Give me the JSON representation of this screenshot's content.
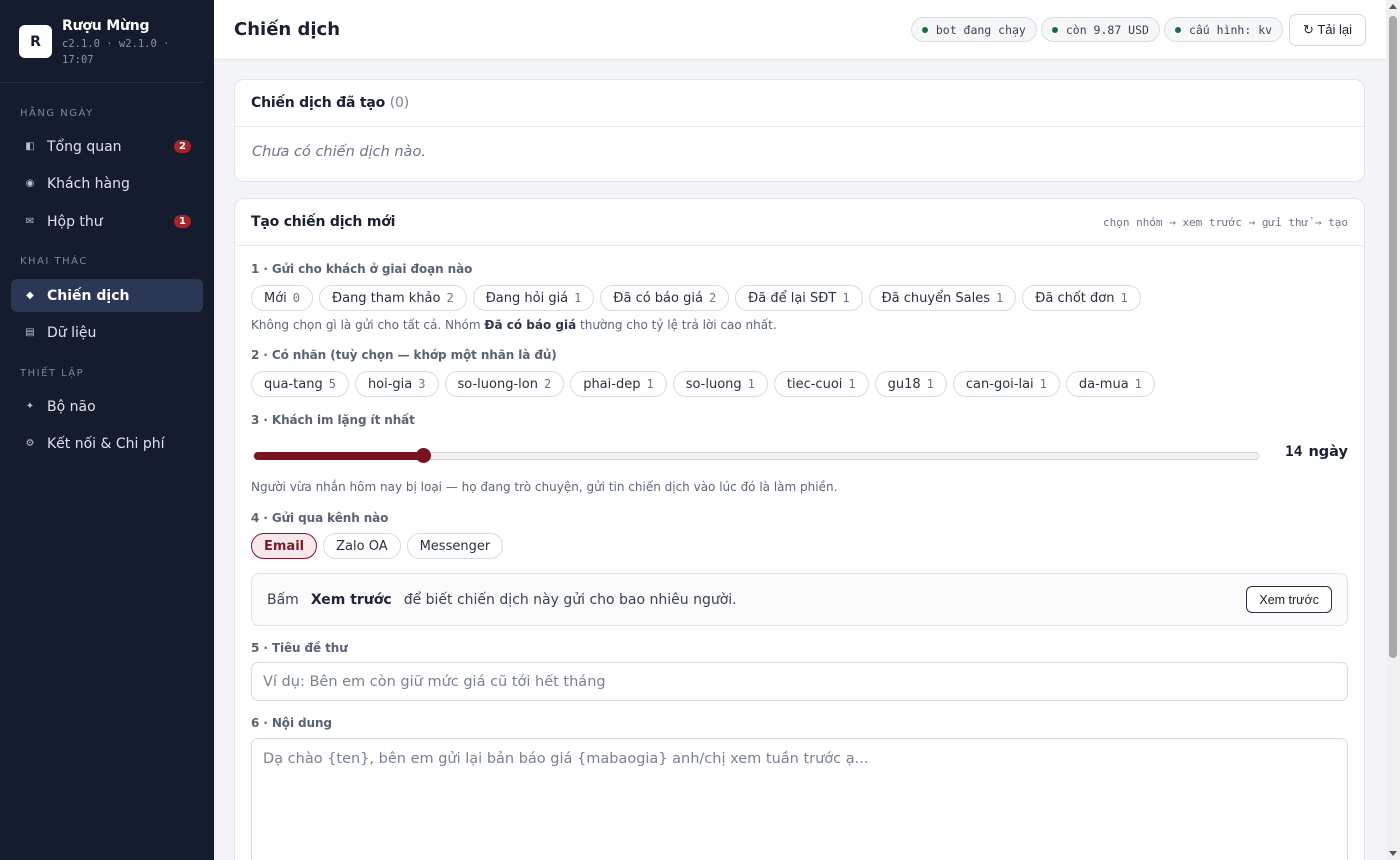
{
  "brand": {
    "logo": "R",
    "name": "Rượu Mừng",
    "version": "c2.1.0 · w2.1.0 · 17:07"
  },
  "nav": {
    "sections": [
      "HẰNG NGÀY",
      "KHAI THÁC",
      "THIẾT LẬP"
    ],
    "items": [
      {
        "label": "Tổng quan",
        "icon": "layout-icon",
        "glyph": "◧",
        "badge": "2"
      },
      {
        "label": "Khách hàng",
        "icon": "target-icon",
        "glyph": "◉",
        "badge": ""
      },
      {
        "label": "Hộp thư",
        "icon": "mail-icon",
        "glyph": "✉",
        "badge": "1"
      },
      {
        "label": "Chiến dịch",
        "icon": "diamond-icon",
        "glyph": "◆",
        "badge": ""
      },
      {
        "label": "Dữ liệu",
        "icon": "list-icon",
        "glyph": "▤",
        "badge": ""
      },
      {
        "label": "Bộ não",
        "icon": "sparkle-icon",
        "glyph": "✦",
        "badge": ""
      },
      {
        "label": "Kết nối & Chi phí",
        "icon": "gear-icon",
        "glyph": "⚙",
        "badge": ""
      }
    ]
  },
  "topbar": {
    "title": "Chiến dịch",
    "status": [
      "bot đang chạy",
      "còn 9.87 USD",
      "cấu hình: kv"
    ],
    "reload_label": "↻ Tải lại"
  },
  "created": {
    "title": "Chiến dịch đã tạo",
    "count": "(0)",
    "empty": "Chưa có chiến dịch nào."
  },
  "create": {
    "title": "Tạo chiến dịch mới",
    "hint": "chọn nhóm → xem trước → gửi thử → tạo",
    "step1": {
      "label": "1 · Gửi cho khách ở giai đoạn nào",
      "stages": [
        {
          "label": "Mới",
          "n": "0"
        },
        {
          "label": "Đang tham khảo",
          "n": "2"
        },
        {
          "label": "Đang hỏi giá",
          "n": "1"
        },
        {
          "label": "Đã có báo giá",
          "n": "2"
        },
        {
          "label": "Đã để lại SĐT",
          "n": "1"
        },
        {
          "label": "Đã chuyển Sales",
          "n": "1"
        },
        {
          "label": "Đã chốt đơn",
          "n": "1"
        }
      ],
      "note_a": "Không chọn gì là gửi cho tất cả. Nhóm ",
      "note_b": "Đã có báo giá",
      "note_c": " thường cho tỷ lệ trả lời cao nhất."
    },
    "step2": {
      "label": "2 · Có nhãn (tuỳ chọn — khớp một nhãn là đủ)",
      "tags": [
        {
          "label": "qua-tang",
          "n": "5"
        },
        {
          "label": "hoi-gia",
          "n": "3"
        },
        {
          "label": "so-luong-lon",
          "n": "2"
        },
        {
          "label": "phai-dep",
          "n": "1"
        },
        {
          "label": "so-luong",
          "n": "1"
        },
        {
          "label": "tiec-cuoi",
          "n": "1"
        },
        {
          "label": "gu18",
          "n": "1"
        },
        {
          "label": "can-goi-lai",
          "n": "1"
        },
        {
          "label": "da-mua",
          "n": "1"
        }
      ]
    },
    "step3": {
      "label": "3 · Khách im lặng ít nhất",
      "value": "14",
      "unit": "ngày",
      "fraction": 0.168,
      "note": "Người vừa nhắn hôm nay bị loại — họ đang trò chuyện, gửi tin chiến dịch vào lúc đó là làm phiền."
    },
    "step4": {
      "label": "4 · Gửi qua kênh nào",
      "channels": [
        "Email",
        "Zalo OA",
        "Messenger"
      ],
      "selected": "Email"
    },
    "preview": {
      "a": "Bấm",
      "b": "Xem trước",
      "c": "để biết chiến dịch này gửi cho bao nhiêu người.",
      "button": "Xem trước"
    },
    "step5": {
      "label": "5 · Tiêu đề thư",
      "placeholder": "Ví dụ: Bên em còn giữ mức giá cũ tới hết tháng"
    },
    "step6": {
      "label": "6 · Nội dung",
      "placeholder": "Dạ chào {ten}, bên em gửi lại bản báo giá {mabaogia} anh/chị xem tuần trước ạ..."
    }
  }
}
